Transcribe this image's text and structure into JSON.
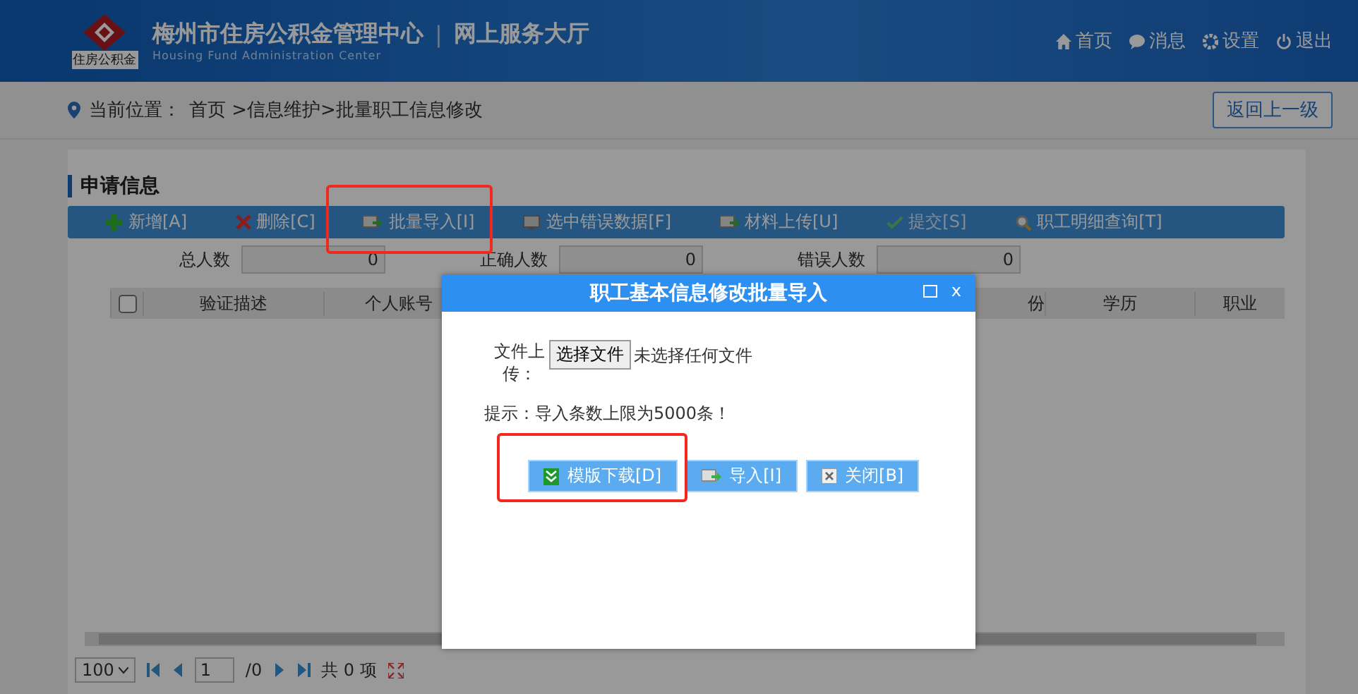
{
  "header": {
    "logo_text": "住房公积金",
    "title": "梅州市住房公积金管理中心",
    "separator": "|",
    "subtitle": "网上服务大厅",
    "english": "Housing Fund Administration Center",
    "nav": [
      {
        "label": "首页"
      },
      {
        "label": "消息"
      },
      {
        "label": "设置"
      },
      {
        "label": "退出"
      }
    ]
  },
  "breadcrumb": {
    "label": "当前位置：",
    "path": "首页 >信息维护>批量职工信息修改",
    "back_button": "返回上一级"
  },
  "section_title": "申请信息",
  "toolbar": [
    {
      "label": "新增[A]",
      "disabled": false
    },
    {
      "label": "删除[C]",
      "disabled": false
    },
    {
      "label": "批量导入[I]",
      "disabled": false
    },
    {
      "label": "选中错误数据[F]",
      "disabled": false
    },
    {
      "label": "材料上传[U]",
      "disabled": false
    },
    {
      "label": "提交[S]",
      "disabled": true
    },
    {
      "label": "职工明细查询[T]",
      "disabled": false
    }
  ],
  "counts": [
    {
      "label": "总人数",
      "value": "0"
    },
    {
      "label": "正确人数",
      "value": "0"
    },
    {
      "label": "错误人数",
      "value": "0"
    }
  ],
  "table": {
    "checked": false,
    "columns": [
      "验证描述",
      "个人账号",
      "份",
      "学历",
      "职业"
    ]
  },
  "pager": {
    "page_size": "100",
    "page": "1",
    "total_pages": "/0",
    "total": "共 0 项"
  },
  "dialog": {
    "title": "职工基本信息修改批量导入",
    "close": "x",
    "file_label": "文件上传：",
    "file_button": "选择文件",
    "file_status": "未选择任何文件",
    "hint": "提示：导入条数上限为5000条！",
    "buttons": [
      {
        "label": "模版下载[D]"
      },
      {
        "label": "导入[I]"
      },
      {
        "label": "关闭[B]"
      }
    ]
  }
}
